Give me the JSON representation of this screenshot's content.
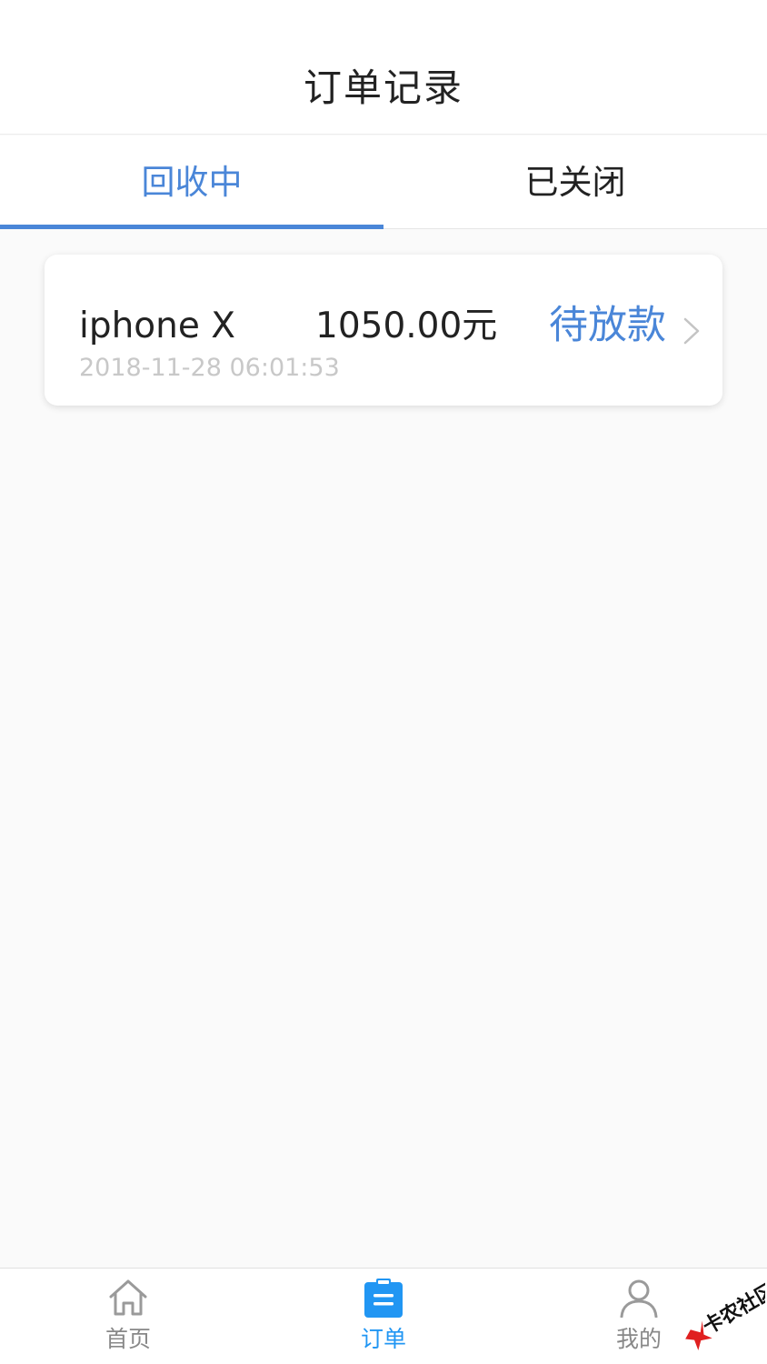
{
  "header": {
    "title": "订单记录"
  },
  "tabs": [
    {
      "label": "回收中",
      "active": true
    },
    {
      "label": "已关闭",
      "active": false
    }
  ],
  "orders": [
    {
      "product": "iphone X",
      "amount": "1050.00元",
      "status": "待放款",
      "date": "2018-11-28 06:01:53"
    }
  ],
  "bottom_nav": [
    {
      "label": "首页",
      "icon": "home-icon",
      "active": false
    },
    {
      "label": "订单",
      "icon": "clipboard-icon",
      "active": true
    },
    {
      "label": "我的",
      "icon": "user-icon",
      "active": false
    }
  ],
  "watermark": {
    "text": "卡农社区"
  },
  "colors": {
    "accent": "#4a86d8",
    "nav_active": "#2196f3",
    "muted": "#c8c8c8"
  }
}
